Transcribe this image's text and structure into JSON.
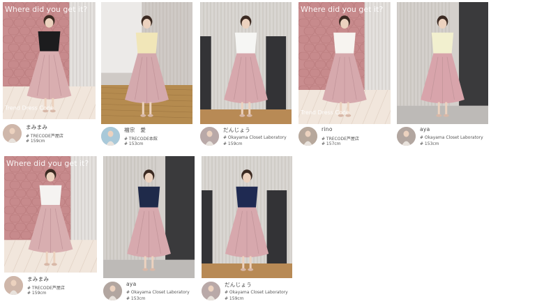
{
  "gallery": {
    "posts": [
      {
        "username": "まみまみ",
        "tag": "# TRECODE芦屋店",
        "height": "# 159cm",
        "overlay": "Where did you get it?",
        "bottom_text": "Trend Dress Code",
        "scene": "pink-wall",
        "top_color": "#1c1c1e",
        "skirt_color": "#d9aeb0",
        "avatar_color": "#cfb7aa"
      },
      {
        "username": "福宗　愛",
        "tag": "# TRECODE本館",
        "height": "# 153cm",
        "overlay": "",
        "bottom_text": "",
        "scene": "wood-room",
        "top_color": "#f1e6b8",
        "skirt_color": "#d4a9ad",
        "avatar_color": "#a9c9d9"
      },
      {
        "username": "だんじょう",
        "tag": "# Okayama Closet Laboratory",
        "height": "# 159cm",
        "overlay": "",
        "bottom_text": "",
        "scene": "studio",
        "top_color": "#f6f6f4",
        "skirt_color": "#d7a8ad",
        "avatar_color": "#b9a9a8"
      },
      {
        "username": "rino",
        "tag": "# TRECODE芦屋店",
        "height": "# 157cm",
        "overlay": "Where did you get it?",
        "bottom_text": "Trend Dress Code",
        "scene": "pink-wall",
        "top_color": "#f7f4f0",
        "skirt_color": "#d6a9ad",
        "avatar_color": "#b7a89c"
      },
      {
        "username": "aya",
        "tag": "# Okayama Closet Laboratory",
        "height": "# 153cm",
        "overlay": "",
        "bottom_text": "",
        "scene": "studio-light",
        "top_color": "#f2f0cf",
        "skirt_color": "#d8a4ab",
        "avatar_color": "#b2a6a0"
      },
      {
        "username": "まみまみ",
        "tag": "# TRECODE芦屋店",
        "height": "# 159cm",
        "overlay": "Where did you get it?",
        "bottom_text": "",
        "scene": "pink-wall",
        "top_color": "#f5f3f1",
        "skirt_color": "#d8aeb0",
        "avatar_color": "#cfb7aa"
      },
      {
        "username": "aya",
        "tag": "# Okayama Closet Laboratory",
        "height": "# 153cm",
        "overlay": "",
        "bottom_text": "",
        "scene": "studio-light",
        "top_color": "#1f2a4a",
        "skirt_color": "#d7a9ae",
        "avatar_color": "#b2a6a0"
      },
      {
        "username": "だんじょう",
        "tag": "# Okayama Closet Laboratory",
        "height": "# 159cm",
        "overlay": "",
        "bottom_text": "",
        "scene": "studio",
        "top_color": "#1f2a52",
        "skirt_color": "#d7a8ad",
        "avatar_color": "#b9a9a8"
      }
    ]
  }
}
